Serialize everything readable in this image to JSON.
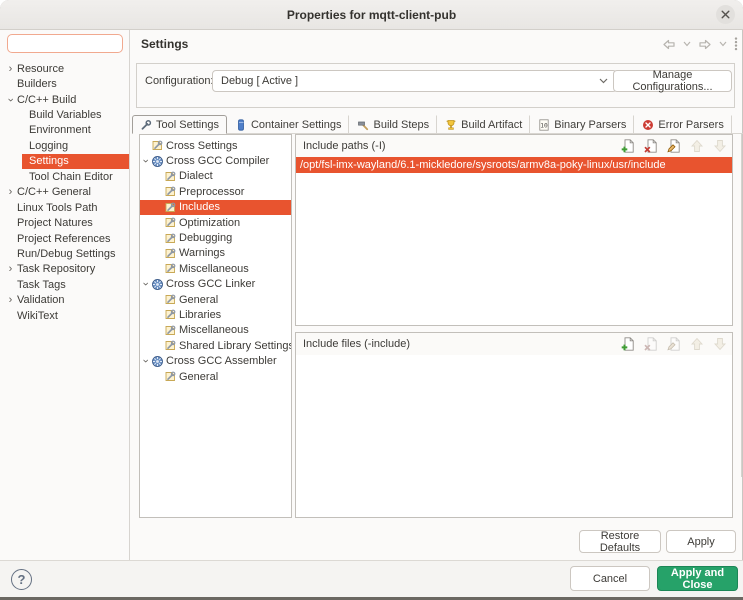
{
  "window": {
    "title": "Properties for mqtt-client-pub"
  },
  "colors": {
    "accent_orange": "#e8542f",
    "accent_green": "#26a269",
    "focus_border": "#f1a98f"
  },
  "sidebar": {
    "filter_value": "",
    "filter_placeholder": "",
    "items": [
      {
        "label": "Resource",
        "level": 0,
        "expander": "collapsed",
        "selected": false
      },
      {
        "label": "Builders",
        "level": 0,
        "expander": "none",
        "selected": false
      },
      {
        "label": "C/C++ Build",
        "level": 0,
        "expander": "expanded",
        "selected": false
      },
      {
        "label": "Build Variables",
        "level": 1,
        "expander": "none",
        "selected": false
      },
      {
        "label": "Environment",
        "level": 1,
        "expander": "none",
        "selected": false
      },
      {
        "label": "Logging",
        "level": 1,
        "expander": "none",
        "selected": false
      },
      {
        "label": "Settings",
        "level": 1,
        "expander": "none",
        "selected": true
      },
      {
        "label": "Tool Chain Editor",
        "level": 1,
        "expander": "none",
        "selected": false
      },
      {
        "label": "C/C++ General",
        "level": 0,
        "expander": "collapsed",
        "selected": false
      },
      {
        "label": "Linux Tools Path",
        "level": 0,
        "expander": "none",
        "selected": false
      },
      {
        "label": "Project Natures",
        "level": 0,
        "expander": "none",
        "selected": false
      },
      {
        "label": "Project References",
        "level": 0,
        "expander": "none",
        "selected": false
      },
      {
        "label": "Run/Debug Settings",
        "level": 0,
        "expander": "none",
        "selected": false
      },
      {
        "label": "Task Repository",
        "level": 0,
        "expander": "collapsed",
        "selected": false
      },
      {
        "label": "Task Tags",
        "level": 0,
        "expander": "none",
        "selected": false
      },
      {
        "label": "Validation",
        "level": 0,
        "expander": "collapsed",
        "selected": false
      },
      {
        "label": "WikiText",
        "level": 0,
        "expander": "none",
        "selected": false
      }
    ]
  },
  "header": {
    "title": "Settings"
  },
  "nav": {
    "icons": [
      "back-arrow",
      "back-history-chevron",
      "forward-arrow",
      "forward-history-chevron",
      "view-menu"
    ]
  },
  "configuration": {
    "label": "Configuration:",
    "value": "Debug [ Active ]",
    "manage_button": "Manage Configurations..."
  },
  "tabs": [
    {
      "label": "Tool Settings",
      "icon": "wrench-icon",
      "active": true
    },
    {
      "label": "Container Settings",
      "icon": "container-icon",
      "active": false
    },
    {
      "label": "Build Steps",
      "icon": "hammer-icon",
      "active": false
    },
    {
      "label": "Build Artifact",
      "icon": "artifact-icon",
      "active": false
    },
    {
      "label": "Binary Parsers",
      "icon": "binary-icon",
      "active": false
    },
    {
      "label": "Error Parsers",
      "icon": "error-icon",
      "active": false
    }
  ],
  "tool_tree": {
    "items": [
      {
        "label": "Cross Settings",
        "level": 0,
        "kind": "category",
        "expander": "none",
        "selected": false
      },
      {
        "label": "Cross GCC Compiler",
        "level": 0,
        "kind": "tool",
        "expander": "expanded",
        "selected": false
      },
      {
        "label": "Dialect",
        "level": 1,
        "kind": "category",
        "expander": "none",
        "selected": false
      },
      {
        "label": "Preprocessor",
        "level": 1,
        "kind": "category",
        "expander": "none",
        "selected": false
      },
      {
        "label": "Includes",
        "level": 1,
        "kind": "category",
        "expander": "none",
        "selected": true
      },
      {
        "label": "Optimization",
        "level": 1,
        "kind": "category",
        "expander": "none",
        "selected": false
      },
      {
        "label": "Debugging",
        "level": 1,
        "kind": "category",
        "expander": "none",
        "selected": false
      },
      {
        "label": "Warnings",
        "level": 1,
        "kind": "category",
        "expander": "none",
        "selected": false
      },
      {
        "label": "Miscellaneous",
        "level": 1,
        "kind": "category",
        "expander": "none",
        "selected": false
      },
      {
        "label": "Cross GCC Linker",
        "level": 0,
        "kind": "tool",
        "expander": "expanded",
        "selected": false
      },
      {
        "label": "General",
        "level": 1,
        "kind": "category",
        "expander": "none",
        "selected": false
      },
      {
        "label": "Libraries",
        "level": 1,
        "kind": "category",
        "expander": "none",
        "selected": false
      },
      {
        "label": "Miscellaneous",
        "level": 1,
        "kind": "category",
        "expander": "none",
        "selected": false
      },
      {
        "label": "Shared Library Settings",
        "level": 1,
        "kind": "category",
        "expander": "none",
        "selected": false
      },
      {
        "label": "Cross GCC Assembler",
        "level": 0,
        "kind": "tool",
        "expander": "expanded",
        "selected": false
      },
      {
        "label": "General",
        "level": 1,
        "kind": "category",
        "expander": "none",
        "selected": false
      }
    ]
  },
  "include_paths": {
    "title": "Include paths (-I)",
    "entries": [
      "/opt/fsl-imx-wayland/6.1-mickledore/sysroots/armv8a-poky-linux/usr/include"
    ],
    "selected_index": 0,
    "toolbar": [
      {
        "name": "add-entry",
        "icon": "add-icon",
        "enabled": true
      },
      {
        "name": "delete-entry",
        "icon": "delete-icon",
        "enabled": true
      },
      {
        "name": "edit-entry",
        "icon": "edit-icon",
        "enabled": true
      },
      {
        "name": "move-entry-up",
        "icon": "move-up-icon",
        "enabled": false
      },
      {
        "name": "move-entry-down",
        "icon": "move-down-icon",
        "enabled": false
      }
    ]
  },
  "include_files": {
    "title": "Include files (-include)",
    "entries": [],
    "selected_index": -1,
    "toolbar": [
      {
        "name": "add-entry",
        "icon": "add-icon",
        "enabled": true
      },
      {
        "name": "delete-entry",
        "icon": "delete-icon",
        "enabled": false
      },
      {
        "name": "edit-entry",
        "icon": "edit-icon",
        "enabled": false
      },
      {
        "name": "move-entry-up",
        "icon": "move-up-icon",
        "enabled": false
      },
      {
        "name": "move-entry-down",
        "icon": "move-down-icon",
        "enabled": false
      }
    ]
  },
  "settings_buttons": {
    "restore_defaults": "Restore Defaults",
    "apply": "Apply"
  },
  "footer": {
    "help": "?",
    "cancel": "Cancel",
    "apply_and_close": "Apply and Close"
  }
}
